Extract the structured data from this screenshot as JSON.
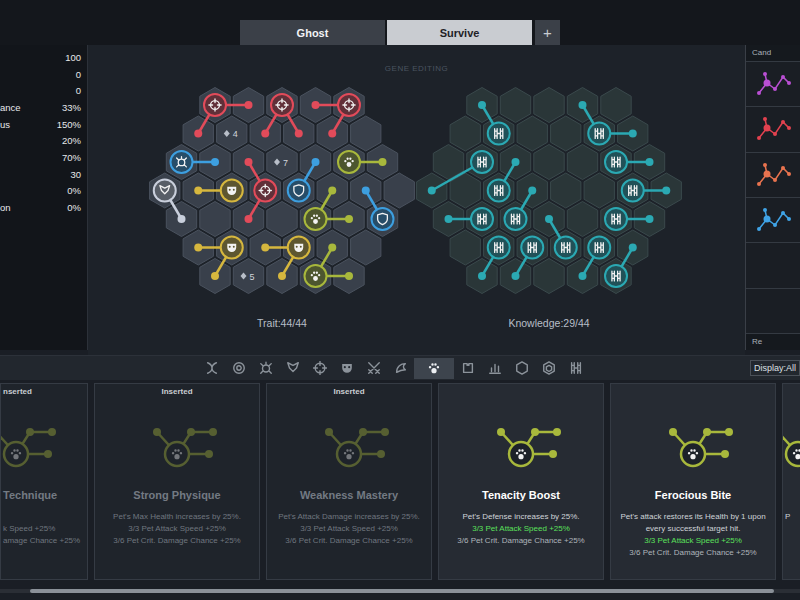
{
  "tabs": [
    {
      "label": "Ghost",
      "selected": false
    },
    {
      "label": "Survive",
      "selected": true
    }
  ],
  "add_tab": "+",
  "stats": [
    {
      "label": "",
      "value": "100"
    },
    {
      "label": "",
      "value": "0"
    },
    {
      "label": "",
      "value": "0"
    },
    {
      "label": "ance",
      "value": "33%"
    },
    {
      "label": "us",
      "value": "150%"
    },
    {
      "label": "",
      "value": "20%"
    },
    {
      "label": "",
      "value": "70%"
    },
    {
      "label": "",
      "value": "30"
    },
    {
      "label": "",
      "value": "0%"
    },
    {
      "label": "on",
      "value": "0%"
    }
  ],
  "editor": {
    "watermark": "GENE EDITING",
    "grids": [
      {
        "name": "trait",
        "label": "Trait:44/44",
        "genes": [
          {
            "color": "#e24b5a",
            "icon": "target",
            "node": [
              0,
              0
            ],
            "paths": [
              [
                [
                  0,
                  1
                ]
              ],
              [
                [
                  1,
                  0
                ]
              ]
            ]
          },
          {
            "color": "#e24b5a",
            "icon": "target",
            "node": [
              0,
              2
            ],
            "paths": [
              [
                [
                  1,
                  2
                ]
              ],
              [
                [
                  1,
                  3
                ]
              ]
            ]
          },
          {
            "color": "#e24b5a",
            "icon": "target",
            "node": [
              0,
              4
            ],
            "paths": [
              [
                [
                  0,
                  3
                ]
              ],
              [
                [
                  1,
                  4
                ]
              ]
            ]
          },
          {
            "color": "#3d9fe0",
            "icon": "turtle",
            "node": [
              2,
              0
            ],
            "paths": [
              [
                [
                  2,
                  1
                ]
              ]
            ]
          },
          {
            "color": "#a8b83c",
            "icon": "paw",
            "node": [
              2,
              5
            ],
            "paths": [
              [
                [
                  2,
                  6
                ]
              ]
            ]
          },
          {
            "color": "#c9cfdc",
            "icon": "wings",
            "node": [
              3,
              0
            ],
            "paths": [
              [
                [
                  4,
                  0
                ]
              ]
            ]
          },
          {
            "color": "#d6b73e",
            "icon": "mask",
            "node": [
              3,
              2
            ],
            "paths": [
              [
                [
                  3,
                  1
                ]
              ]
            ]
          },
          {
            "color": "#e24b5a",
            "icon": "target",
            "node": [
              3,
              3
            ],
            "paths": [
              [
                [
                  4,
                  2
                ]
              ],
              [
                [
                  2,
                  2
                ]
              ]
            ]
          },
          {
            "color": "#3d9fe0",
            "icon": "shield",
            "node": [
              3,
              4
            ],
            "paths": [
              [
                [
                  2,
                  4
                ]
              ]
            ]
          },
          {
            "color": "#a8b83c",
            "icon": "paw",
            "node": [
              4,
              4
            ],
            "paths": [
              [
                [
                  3,
                  5
                ]
              ],
              [
                [
                  4,
                  5
                ]
              ]
            ]
          },
          {
            "color": "#3d9fe0",
            "icon": "shield",
            "node": [
              4,
              6
            ],
            "paths": [
              [
                [
                  3,
                  6
                ]
              ]
            ]
          },
          {
            "color": "#d6b73e",
            "icon": "mask",
            "node": [
              5,
              1
            ],
            "paths": [
              [
                [
                  5,
                  0
                ]
              ],
              [
                [
                  6,
                  0
                ]
              ]
            ]
          },
          {
            "color": "#d6b73e",
            "icon": "mask",
            "node": [
              5,
              3
            ],
            "paths": [
              [
                [
                  5,
                  2
                ]
              ],
              [
                [
                  6,
                  2
                ]
              ]
            ]
          },
          {
            "color": "#a8b83c",
            "icon": "paw",
            "node": [
              6,
              3
            ],
            "paths": [
              [
                [
                  5,
                  4
                ]
              ],
              [
                [
                  6,
                  4
                ]
              ]
            ]
          }
        ],
        "badges": [
          {
            "cell": [
              1,
              1
            ],
            "text": "4"
          },
          {
            "cell": [
              2,
              3
            ],
            "text": "7"
          },
          {
            "cell": [
              6,
              1
            ],
            "text": "5"
          }
        ]
      },
      {
        "name": "knowledge",
        "label": "Knowledge:29/44",
        "genes": [
          {
            "color": "#2ba9b3",
            "icon": "dna",
            "node": [
              1,
              1
            ],
            "paths": [
              [
                [
                  0,
                  0
                ]
              ]
            ]
          },
          {
            "color": "#2ba9b3",
            "icon": "dna",
            "node": [
              1,
              4
            ],
            "paths": [
              [
                [
                  0,
                  3
                ]
              ],
              [
                [
                  1,
                  5
                ]
              ]
            ]
          },
          {
            "color": "#2ba9b3",
            "icon": "dna",
            "node": [
              2,
              1
            ],
            "paths": [
              [
                [
                  3,
                  0
                ]
              ]
            ]
          },
          {
            "color": "#2ba9b3",
            "icon": "dna",
            "node": [
              2,
              5
            ],
            "paths": [
              [
                [
                  2,
                  6
                ]
              ]
            ]
          },
          {
            "color": "#2ba9b3",
            "icon": "dna",
            "node": [
              3,
              2
            ],
            "paths": [
              [
                [
                  2,
                  2
                ]
              ]
            ]
          },
          {
            "color": "#2ba9b3",
            "icon": "dna",
            "node": [
              3,
              6
            ],
            "paths": [
              [
                [
                  3,
                  7
                ]
              ]
            ]
          },
          {
            "color": "#2ba9b3",
            "icon": "dna",
            "node": [
              4,
              1
            ],
            "paths": [
              [
                [
                  4,
                  0
                ]
              ]
            ]
          },
          {
            "color": "#2ba9b3",
            "icon": "dna",
            "node": [
              4,
              5
            ],
            "paths": [
              [
                [
                  4,
                  6
                ]
              ]
            ]
          },
          {
            "color": "#2ba9b3",
            "icon": "dna",
            "node": [
              5,
              1
            ],
            "paths": [
              [
                [
                  6,
                  0
                ]
              ]
            ]
          },
          {
            "color": "#2ba9b3",
            "icon": "dna",
            "node": [
              5,
              2
            ],
            "paths": [
              [
                [
                  6,
                  1
                ]
              ]
            ]
          },
          {
            "color": "#2ba9b3",
            "icon": "dna",
            "node": [
              5,
              3
            ],
            "paths": [
              [
                [
                  4,
                  3
                ]
              ]
            ]
          },
          {
            "color": "#2ba9b3",
            "icon": "dna",
            "node": [
              5,
              4
            ],
            "paths": [
              [
                [
                  6,
                  3
                ]
              ]
            ]
          },
          {
            "color": "#2ba9b3",
            "icon": "dna",
            "node": [
              4,
              2
            ],
            "paths": [
              [
                [
                  3,
                  3
                ]
              ]
            ]
          },
          {
            "color": "#2ba9b3",
            "icon": "dna",
            "node": [
              6,
              4
            ],
            "paths": [
              [
                [
                  5,
                  5
                ]
              ]
            ]
          }
        ],
        "badges": []
      }
    ]
  },
  "candidates": {
    "title": "Cand",
    "footer": "Re",
    "items": [
      {
        "kind": "gene",
        "color": "#b94fd3"
      },
      {
        "kind": "gene",
        "color": "#e2414f"
      },
      {
        "kind": "gene",
        "color": "#e8734f"
      },
      {
        "kind": "gene",
        "color": "#3fa3e6"
      },
      {
        "kind": "empty",
        "color": ""
      },
      {
        "kind": "empty",
        "color": ""
      }
    ]
  },
  "filters": [
    {
      "kind": "knot",
      "selected": false
    },
    {
      "kind": "orb",
      "selected": false
    },
    {
      "kind": "turtle",
      "selected": false
    },
    {
      "kind": "wings",
      "selected": false
    },
    {
      "kind": "target",
      "selected": false
    },
    {
      "kind": "mask",
      "selected": false
    },
    {
      "kind": "swords",
      "selected": false
    },
    {
      "kind": "dragon",
      "selected": false
    },
    {
      "kind": "paw",
      "selected": true
    },
    {
      "kind": "puzzle",
      "selected": false
    },
    {
      "kind": "chart",
      "selected": false
    },
    {
      "kind": "hex",
      "selected": false
    },
    {
      "kind": "hexring",
      "selected": false
    },
    {
      "kind": "dna",
      "selected": false
    }
  ],
  "display": {
    "label": "Display:All"
  },
  "cards": [
    {
      "kind": "partial",
      "inserted": true,
      "badge": "nserted",
      "color": "#a8b83c",
      "title": "Technique",
      "description": "",
      "bonuses": [
        {
          "text": "k Speed +25%",
          "active": false
        },
        {
          "text": "amage Chance +25%",
          "active": false
        }
      ]
    },
    {
      "kind": "full",
      "inserted": true,
      "badge": "Inserted",
      "color": "#a8b83c",
      "title": "Strong Physique",
      "description": "Pet's Max Health increases by 25%.",
      "bonuses": [
        {
          "text": "3/3 Pet Attack Speed +25%",
          "active": false
        },
        {
          "text": "3/6 Pet Crit. Damage Chance +25%",
          "active": false
        }
      ]
    },
    {
      "kind": "full",
      "inserted": true,
      "badge": "Inserted",
      "color": "#a8b83c",
      "title": "Weakness Mastery",
      "description": "Pet's Attack Damage increases by 25%.",
      "bonuses": [
        {
          "text": "3/3 Pet Attack Speed +25%",
          "active": false
        },
        {
          "text": "3/6 Pet Crit. Damage Chance +25%",
          "active": false
        }
      ]
    },
    {
      "kind": "full",
      "inserted": false,
      "badge": "",
      "color": "#a8b83c",
      "title": "Tenacity Boost",
      "description": "Pet's Defense increases by 25%.",
      "bonuses": [
        {
          "text": "3/3 Pet Attack Speed +25%",
          "active": true
        },
        {
          "text": "3/6 Pet Crit. Damage Chance +25%",
          "active": false
        }
      ]
    },
    {
      "kind": "full",
      "inserted": false,
      "badge": "",
      "color": "#a8b83c",
      "title": "Ferocious Bite",
      "description": "Pet's attack restores its Health by 1 upon every successful target hit.",
      "bonuses": [
        {
          "text": "3/3 Pet Attack Speed +25%",
          "active": true
        },
        {
          "text": "3/6 Pet Crit. Damage Chance +25%",
          "active": false
        }
      ]
    },
    {
      "kind": "partial",
      "inserted": false,
      "badge": "",
      "color": "#a8b83c",
      "title": "",
      "description": "P",
      "bonuses": []
    }
  ],
  "scrollbar": {
    "level": 0.93
  }
}
